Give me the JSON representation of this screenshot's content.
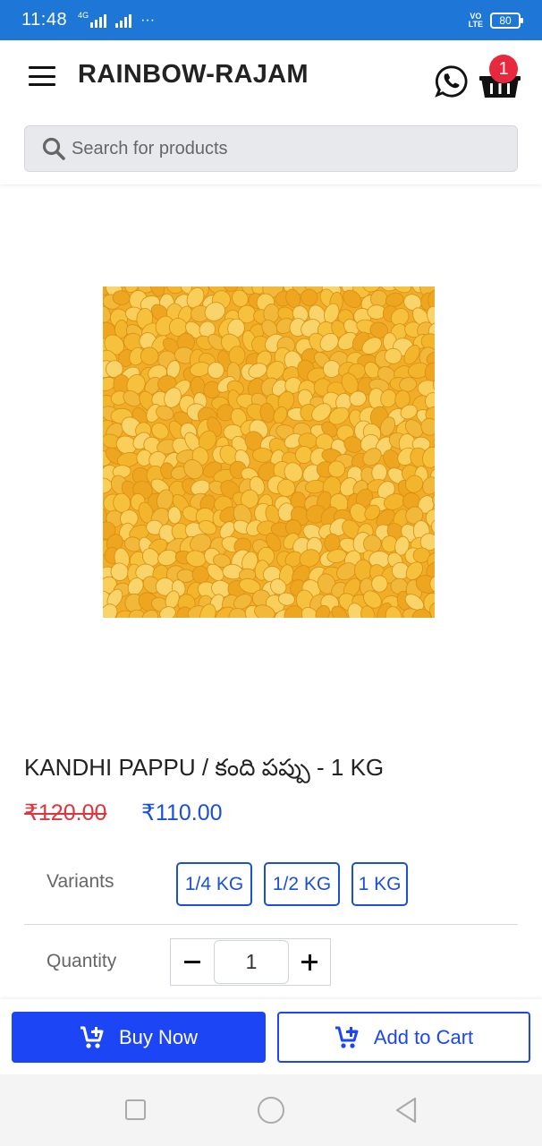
{
  "status_bar": {
    "time": "11:48",
    "network": "4G",
    "more": "···",
    "volte_line1": "VO",
    "volte_line2": "LTE",
    "battery": "80"
  },
  "header": {
    "brand": "RAINBOW-RAJAM",
    "cart_count": "1",
    "whatsapp_icon": "whatsapp-icon",
    "cart_icon": "basket-icon",
    "menu_icon": "hamburger-icon"
  },
  "search": {
    "placeholder": "Search for products"
  },
  "product": {
    "title": "KANDHI PAPPU / కంది పప్పు - 1 KG",
    "old_price": "₹120.00",
    "price": "₹110.00",
    "image_alt": "Toor dal"
  },
  "variants": {
    "label": "Variants",
    "options": [
      "1/4 KG",
      "1/2 KG",
      "1 KG"
    ]
  },
  "quantity": {
    "label": "Quantity",
    "value": "1"
  },
  "actions": {
    "buy_now": "Buy Now",
    "add_to_cart": "Add to Cart"
  },
  "colors": {
    "status_bar": "#1e76d6",
    "primary": "#1c45f5",
    "old_price": "#e0353b",
    "badge": "#e8283c"
  }
}
